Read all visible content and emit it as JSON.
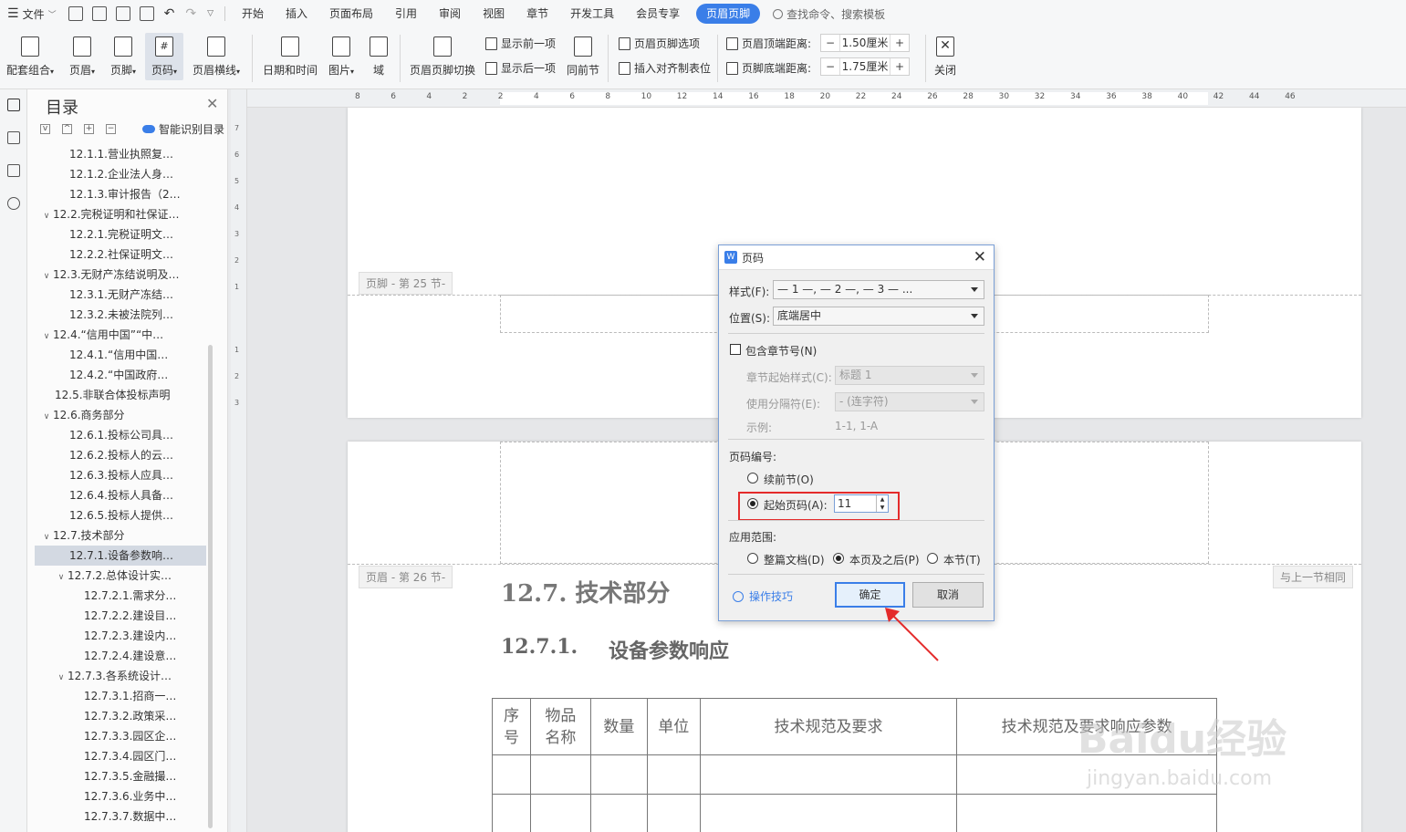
{
  "menubar": {
    "file_label": "文件",
    "tabs": [
      "开始",
      "插入",
      "页面布局",
      "引用",
      "审阅",
      "视图",
      "章节",
      "开发工具",
      "会员专享"
    ],
    "active_tab": "页眉页脚",
    "search_placeholder": "查找命令、搜索模板"
  },
  "ribbon": {
    "combo": "配套组合",
    "header": "页眉",
    "footer": "页脚",
    "page_number": "页码",
    "header_line": "页眉横线",
    "datetime": "日期和时间",
    "picture": "图片",
    "field": "域",
    "switch": "页眉页脚切换",
    "show_prev": "显示前一项",
    "show_next": "显示后一项",
    "same_as_prev": "同前节",
    "hf_options": "页眉页脚选项",
    "insert_tab": "插入对齐制表位",
    "header_top_label": "页眉顶端距离:",
    "header_top_value": "1.50厘米",
    "footer_bottom_label": "页脚底端距离:",
    "footer_bottom_value": "1.75厘米",
    "close": "关闭",
    "minus": "−",
    "plus": "+"
  },
  "toc": {
    "title": "目录",
    "smart_label": "智能识别目录",
    "items": [
      {
        "text": "12.1.1.营业执照复…",
        "level": 3,
        "arrow": "",
        "selected": false
      },
      {
        "text": "12.1.2.企业法人身…",
        "level": 3,
        "arrow": "",
        "selected": false
      },
      {
        "text": "12.1.3.审计报告（2…",
        "level": 3,
        "arrow": "",
        "selected": false
      },
      {
        "text": "12.2.完税证明和社保证…",
        "level": 2,
        "arrow": "v",
        "selected": false
      },
      {
        "text": "12.2.1.完税证明文…",
        "level": 3,
        "arrow": "",
        "selected": false
      },
      {
        "text": "12.2.2.社保证明文…",
        "level": 3,
        "arrow": "",
        "selected": false
      },
      {
        "text": "12.3.无财产冻结说明及…",
        "level": 2,
        "arrow": "v",
        "selected": false
      },
      {
        "text": "12.3.1.无财产冻结…",
        "level": 3,
        "arrow": "",
        "selected": false
      },
      {
        "text": "12.3.2.未被法院列…",
        "level": 3,
        "arrow": "",
        "selected": false
      },
      {
        "text": "12.4.“信用中国”“中…",
        "level": 2,
        "arrow": "v",
        "selected": false
      },
      {
        "text": "12.4.1.“信用中国…",
        "level": 3,
        "arrow": "",
        "selected": false
      },
      {
        "text": "12.4.2.“中国政府…",
        "level": 3,
        "arrow": "",
        "selected": false
      },
      {
        "text": "12.5.非联合体投标声明",
        "level": 2,
        "arrow": "",
        "selected": false
      },
      {
        "text": "12.6.商务部分",
        "level": 2,
        "arrow": "v",
        "selected": false
      },
      {
        "text": "12.6.1.投标公司具…",
        "level": 3,
        "arrow": "",
        "selected": false
      },
      {
        "text": "12.6.2.投标人的云…",
        "level": 3,
        "arrow": "",
        "selected": false
      },
      {
        "text": "12.6.3.投标人应具…",
        "level": 3,
        "arrow": "",
        "selected": false
      },
      {
        "text": "12.6.4.投标人具备…",
        "level": 3,
        "arrow": "",
        "selected": false
      },
      {
        "text": "12.6.5.投标人提供…",
        "level": 3,
        "arrow": "",
        "selected": false
      },
      {
        "text": "12.7.技术部分",
        "level": 2,
        "arrow": "v",
        "selected": false
      },
      {
        "text": "12.7.1.设备参数响…",
        "level": 3,
        "arrow": "",
        "selected": true
      },
      {
        "text": "12.7.2.总体设计实…",
        "level": 3,
        "arrow": "v",
        "selected": false
      },
      {
        "text": "12.7.2.1.需求分…",
        "level": 4,
        "arrow": "",
        "selected": false
      },
      {
        "text": "12.7.2.2.建设目…",
        "level": 4,
        "arrow": "",
        "selected": false
      },
      {
        "text": "12.7.2.3.建设内…",
        "level": 4,
        "arrow": "",
        "selected": false
      },
      {
        "text": "12.7.2.4.建设意…",
        "level": 4,
        "arrow": "",
        "selected": false
      },
      {
        "text": "12.7.3.各系统设计…",
        "level": 3,
        "arrow": "v",
        "selected": false
      },
      {
        "text": "12.7.3.1.招商一…",
        "level": 4,
        "arrow": "",
        "selected": false
      },
      {
        "text": "12.7.3.2.政策采…",
        "level": 4,
        "arrow": "",
        "selected": false
      },
      {
        "text": "12.7.3.3.园区企…",
        "level": 4,
        "arrow": "",
        "selected": false
      },
      {
        "text": "12.7.3.4.园区门…",
        "level": 4,
        "arrow": "",
        "selected": false
      },
      {
        "text": "12.7.3.5.金融撮…",
        "level": 4,
        "arrow": "",
        "selected": false
      },
      {
        "text": "12.7.3.6.业务中…",
        "level": 4,
        "arrow": "",
        "selected": false
      },
      {
        "text": "12.7.3.7.数据中…",
        "level": 4,
        "arrow": "",
        "selected": false
      }
    ]
  },
  "ruler": {
    "h_ticks": [
      "8",
      "6",
      "4",
      "2",
      "2",
      "4",
      "6",
      "8",
      "10",
      "12",
      "14",
      "16",
      "18",
      "20",
      "22",
      "24",
      "26",
      "28",
      "30",
      "32",
      "34",
      "36",
      "38",
      "40",
      "42",
      "44",
      "46"
    ],
    "v_ticks": [
      "7",
      "6",
      "5",
      "4",
      "3",
      "2",
      "1",
      "1",
      "2",
      "3"
    ]
  },
  "document": {
    "footer_tag": "页脚 - 第 25 节-",
    "header_tag": "页眉 - 第 26 节-",
    "same_as_prev_tag": "与上一节相同",
    "heading1": "12.7.  技术部分",
    "heading2_num": "12.7.1.",
    "heading2_text": "设备参数响应",
    "table_headers": [
      "序\n号",
      "物品\n名称",
      "数量",
      "单位",
      "技术规范及要求",
      "技术规范及要求响应参数"
    ]
  },
  "watermark": {
    "brand": "Baidu经验",
    "url": "jingyan.baidu.com"
  },
  "dialog": {
    "title": "页码",
    "style_label": "样式(F):",
    "style_value": "— 1 —, — 2 —, — 3 — ...",
    "position_label": "位置(S):",
    "position_value": "底端居中",
    "include_chapter_label": "包含章节号(N)",
    "chapter_start_label": "章节起始样式(C):",
    "chapter_start_value": "标题 1",
    "separator_label": "使用分隔符(E):",
    "separator_value": "-   (连字符)",
    "example_label": "示例:",
    "example_value": "1-1, 1-A",
    "numbering_label": "页码编号:",
    "continue_label": "续前节(O)",
    "start_label": "起始页码(A):",
    "start_value": "11",
    "scope_label": "应用范围:",
    "scope_whole": "整篇文档(D)",
    "scope_after": "本页及之后(P)",
    "scope_section": "本节(T)",
    "tips_label": "操作技巧",
    "ok_label": "确定",
    "cancel_label": "取消"
  }
}
